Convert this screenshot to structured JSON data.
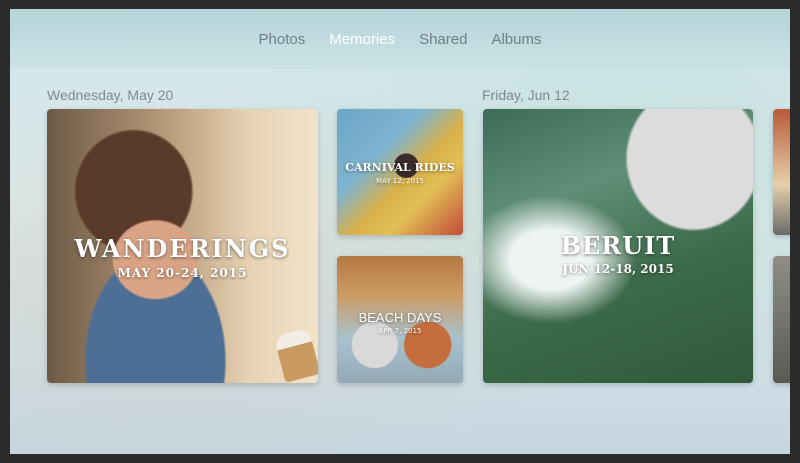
{
  "nav": {
    "tabs": [
      {
        "label": "Photos",
        "active": false
      },
      {
        "label": "Memories",
        "active": true
      },
      {
        "label": "Shared",
        "active": false
      },
      {
        "label": "Albums",
        "active": false
      }
    ]
  },
  "sections": [
    {
      "date": "Wednesday, May 20",
      "memories": [
        {
          "title": "WANDERINGS",
          "dates": "MAY 20-24, 2015"
        },
        {
          "title": "CARNIVAL RIDES",
          "dates": "MAY 12, 2015"
        },
        {
          "title": "BEACH DAYS",
          "dates": "APR 7, 2015"
        }
      ]
    },
    {
      "date": "Friday, Jun 12",
      "memories": [
        {
          "title": "BERUIT",
          "dates": "JUN 12-18, 2015"
        }
      ]
    }
  ],
  "colors": {
    "active_tab": "#ffffff",
    "inactive_tab": "#6f7f86",
    "date_label": "#7f8a8f",
    "frame": "#2b2b2b"
  }
}
